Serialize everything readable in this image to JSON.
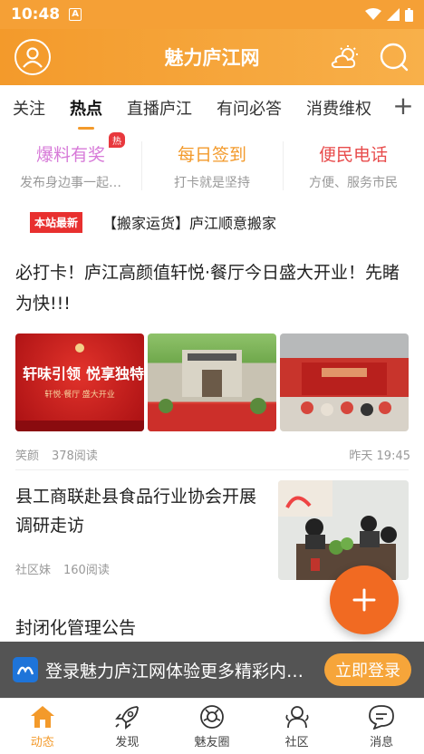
{
  "status_bar": {
    "time": "10:48",
    "notification_badge": "A"
  },
  "app_bar": {
    "title": "魅力庐江网"
  },
  "tabs": [
    {
      "label": "关注",
      "active": false
    },
    {
      "label": "热点",
      "active": true
    },
    {
      "label": "直播庐江",
      "active": false
    },
    {
      "label": "有问必答",
      "active": false
    },
    {
      "label": "消费维权",
      "active": false
    }
  ],
  "quick_links": [
    {
      "title": "爆料有奖",
      "subtitle": "发布身边事一起…",
      "badge": "热",
      "color": "#d77ad8"
    },
    {
      "title": "每日签到",
      "subtitle": "打卡就是坚持",
      "color": "#f39a2b"
    },
    {
      "title": "便民电话",
      "subtitle": "方便、服务市民",
      "color": "#e84c4c"
    }
  ],
  "notice": {
    "badge": "本站最新",
    "text": "【搬家运货】庐江顺意搬家"
  },
  "articles": [
    {
      "title": "必打卡！庐江高颜值轩悦·餐厅今日盛大开业！先睹为快!!!",
      "author": "笑颜",
      "views": "378阅读",
      "time": "昨天 19:45",
      "image_texts": [
        "轩味引领",
        "悦享独特",
        "轩悦·餐厅 盛大开业"
      ]
    },
    {
      "title": "县工商联赴县食品行业协会开展调研走访",
      "author": "社区妹",
      "views": "160阅读"
    },
    {
      "title": "封闭化管理公告"
    }
  ],
  "login_bar": {
    "text": "登录魅力庐江网体验更多精彩内…",
    "button": "立即登录"
  },
  "bottom_nav": [
    {
      "label": "动态",
      "icon": "home-icon",
      "active": true
    },
    {
      "label": "发现",
      "icon": "rocket-icon",
      "active": false
    },
    {
      "label": "魅友圈",
      "icon": "camera-icon",
      "active": false
    },
    {
      "label": "社区",
      "icon": "community-icon",
      "active": false
    },
    {
      "label": "消息",
      "icon": "message-icon",
      "active": false
    }
  ],
  "colors": {
    "accent": "#f39a2b",
    "fab": "#f16a22",
    "badge_red": "#e8302f"
  }
}
